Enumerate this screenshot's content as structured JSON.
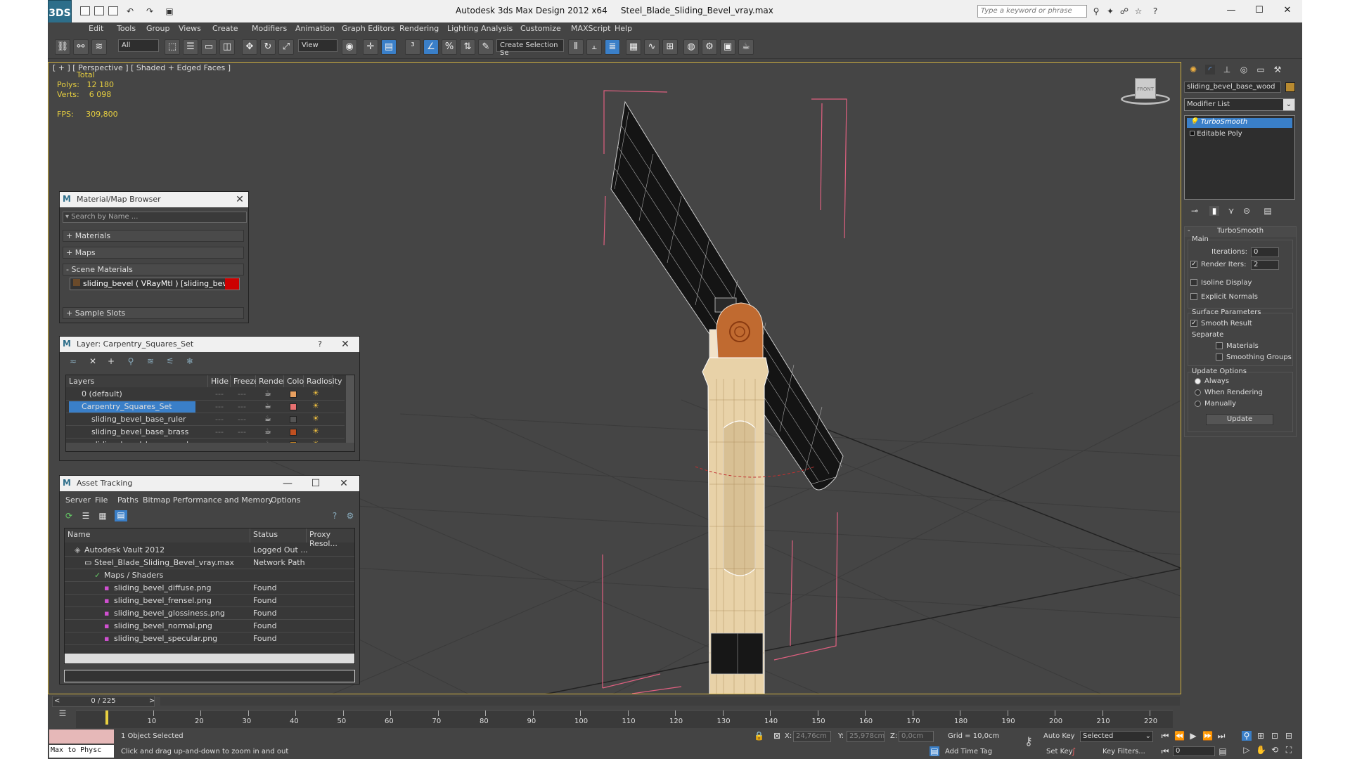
{
  "titlebar": {
    "app_title": "Autodesk 3ds Max Design 2012 x64",
    "file_title": "Steel_Blade_Sliding_Bevel_vray.max",
    "search_placeholder": "Type a keyword or phrase",
    "logo_text": "3DS"
  },
  "menu": [
    "Edit",
    "Tools",
    "Group",
    "Views",
    "Create",
    "Modifiers",
    "Animation",
    "Graph Editors",
    "Rendering",
    "Lighting Analysis",
    "Customize",
    "MAXScript",
    "Help"
  ],
  "toolbar": {
    "selection_filter": "All",
    "ref_coord": "View",
    "named_selection": "Create Selection Se"
  },
  "viewport": {
    "label": "[ + ] [ Perspective ] [ Shaded + Edged Faces ]",
    "stats_header": "Total",
    "polys_label": "Polys:",
    "polys_value": "12 180",
    "verts_label": "Verts:",
    "verts_value": "6 098",
    "fps_label": "FPS:",
    "fps_value": "309,800",
    "viewcube_label": "FRONT"
  },
  "material_browser": {
    "title": "Material/Map Browser",
    "search_placeholder": "Search by Name ...",
    "sections": [
      "+ Materials",
      "+ Maps",
      "- Scene Materials",
      "+ Sample Slots"
    ],
    "scene_material": "sliding_bevel ( VRayMtl ) [sliding_bevel_ba..."
  },
  "layer_manager": {
    "title": "Layer: Carpentry_Squares_Set",
    "help": "?",
    "columns": [
      "Layers",
      "Hide",
      "Freeze",
      "Render",
      "Color",
      "Radiosity"
    ],
    "rows": [
      {
        "name": "0 (default)",
        "color": "#e8a060"
      },
      {
        "name": "Carpentry_Squares_Set",
        "color": "#e87070"
      },
      {
        "name": "sliding_bevel_base_ruler",
        "color": "#555555"
      },
      {
        "name": "sliding_bevel_base_brass",
        "color": "#c05020"
      },
      {
        "name": "sliding_bevel_base_wood",
        "color": "#c08020"
      }
    ]
  },
  "asset_tracking": {
    "title": "Asset Tracking",
    "menu": [
      "Server",
      "File",
      "Paths",
      "Bitmap Performance and Memory",
      "Options"
    ],
    "columns": [
      "Name",
      "Status",
      "Proxy Resol..."
    ],
    "rows": [
      {
        "name": "Autodesk Vault 2012",
        "status": "Logged Out ...",
        "indent": 0
      },
      {
        "name": "Steel_Blade_Sliding_Bevel_vray.max",
        "status": "Network Path",
        "indent": 1
      },
      {
        "name": "Maps / Shaders",
        "status": "",
        "indent": 2
      },
      {
        "name": "sliding_bevel_diffuse.png",
        "status": "Found",
        "indent": 3
      },
      {
        "name": "sliding_bevel_frensel.png",
        "status": "Found",
        "indent": 3
      },
      {
        "name": "sliding_bevel_glossiness.png",
        "status": "Found",
        "indent": 3
      },
      {
        "name": "sliding_bevel_normal.png",
        "status": "Found",
        "indent": 3
      },
      {
        "name": "sliding_bevel_specular.png",
        "status": "Found",
        "indent": 3
      }
    ]
  },
  "command_panel": {
    "object_name": "sliding_bevel_base_wood",
    "modifier_list": "Modifier List",
    "stack": [
      "TurboSmooth",
      "Editable Poly"
    ],
    "rollout_title": "TurboSmooth",
    "main_group": "Main",
    "iterations_label": "Iterations:",
    "iterations_value": "0",
    "render_iters_label": "Render Iters:",
    "render_iters_value": "2",
    "isoline": "Isoline Display",
    "explicit_normals": "Explicit Normals",
    "surface_group": "Surface Parameters",
    "smooth_result": "Smooth Result",
    "separate": "Separate",
    "materials": "Materials",
    "smoothing_groups": "Smoothing Groups",
    "update_group": "Update Options",
    "always": "Always",
    "when_rendering": "When Rendering",
    "manually": "Manually",
    "update_button": "Update"
  },
  "timeline": {
    "frame_counter": "0 / 225",
    "ticks": [
      "10",
      "20",
      "30",
      "40",
      "50",
      "60",
      "70",
      "80",
      "90",
      "100",
      "110",
      "120",
      "130",
      "140",
      "150",
      "160",
      "170",
      "180",
      "190",
      "200",
      "210",
      "220"
    ]
  },
  "status": {
    "maxscript": "Max to Physc",
    "selected": "1 Object Selected",
    "prompt": "Click and drag up-and-down to zoom in and out",
    "x_label": "X:",
    "x_value": "24,76cm",
    "y_label": "Y:",
    "y_value": "25,978cm",
    "z_label": "Z:",
    "z_value": "0,0cm",
    "grid": "Grid = 10,0cm",
    "auto_key": "Auto Key",
    "key_mode": "Selected",
    "set_key": "Set Key",
    "key_filters": "Key Filters...",
    "add_time_tag": "Add Time Tag",
    "frame_value": "0"
  }
}
